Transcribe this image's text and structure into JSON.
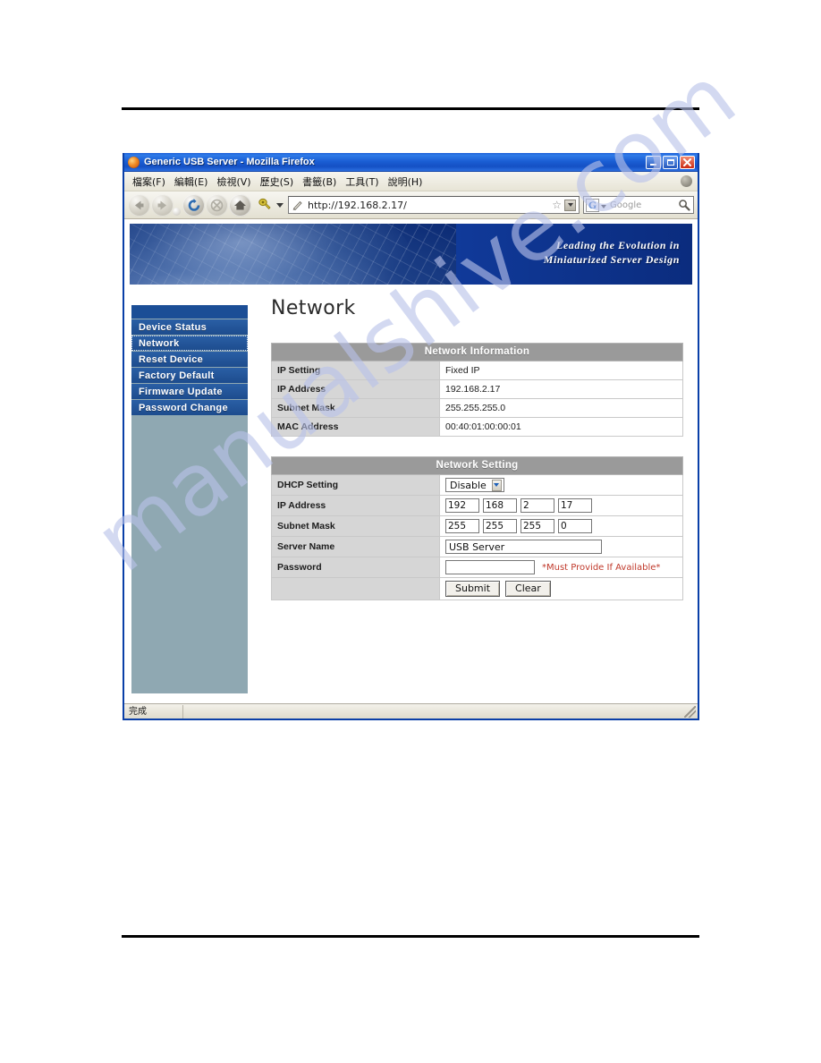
{
  "browser": {
    "title": "Generic USB Server - Mozilla Firefox",
    "window_controls": {
      "minimize": "_",
      "maximize": "□",
      "close": "✕"
    },
    "menu": [
      {
        "label": "檔案(F)"
      },
      {
        "label": "編輯(E)"
      },
      {
        "label": "檢視(V)"
      },
      {
        "label": "歷史(S)"
      },
      {
        "label": "書籤(B)"
      },
      {
        "label": "工具(T)"
      },
      {
        "label": "說明(H)"
      }
    ],
    "toolbar": {
      "back": "back-icon",
      "forward": "forward-icon",
      "reload": "reload-icon",
      "stop": "stop-icon",
      "home": "home-icon",
      "bookmark": "bookmark-icon"
    },
    "address_bar": {
      "url": "http://192.168.2.17/",
      "star": "☆",
      "go": "go-icon"
    },
    "search_bar": {
      "engine_letter": "G",
      "placeholder": "Google",
      "magnifier": "search-icon"
    },
    "status": {
      "text": "完成"
    }
  },
  "banner": {
    "tagline_line1": "Leading the Evolution in",
    "tagline_line2": "Miniaturized Server Design"
  },
  "sidebar": {
    "items": [
      {
        "label": "Device Status",
        "active": false
      },
      {
        "label": "Network",
        "active": true
      },
      {
        "label": "Reset Device",
        "active": false
      },
      {
        "label": "Factory Default",
        "active": false
      },
      {
        "label": "Firmware Update",
        "active": false
      },
      {
        "label": "Password Change",
        "active": false
      }
    ]
  },
  "main": {
    "page_title": "Network",
    "network_information": {
      "header": "Network Information",
      "rows": [
        {
          "label": "IP Setting",
          "value": "Fixed IP"
        },
        {
          "label": "IP Address",
          "value": "192.168.2.17"
        },
        {
          "label": "Subnet Mask",
          "value": "255.255.255.0"
        },
        {
          "label": "MAC Address",
          "value": "00:40:01:00:00:01"
        }
      ]
    },
    "network_setting": {
      "header": "Network Setting",
      "dhcp_label": "DHCP Setting",
      "dhcp_value": "Disable",
      "ip_label": "IP Address",
      "ip_octets": [
        "192",
        "168",
        "2",
        "17"
      ],
      "subnet_label": "Subnet Mask",
      "subnet_octets": [
        "255",
        "255",
        "255",
        "0"
      ],
      "server_name_label": "Server Name",
      "server_name_value": "USB Server",
      "password_label": "Password",
      "password_value": "",
      "password_hint": "*Must Provide If Available*",
      "submit_label": "Submit",
      "clear_label": "Clear",
      "dot_separator": "."
    }
  },
  "watermark": {
    "text": "manualshive.com"
  },
  "colors": {
    "titlebar_blue": "#1450C4",
    "sidebar_nav_blue": "#1d4c8e",
    "sidebar_bg": "#8fa8b2",
    "panel_header_gray": "#9a9a9a",
    "label_cell_gray": "#d6d6d6",
    "hint_red": "#c0392b",
    "banner_blue": "#123da0"
  }
}
